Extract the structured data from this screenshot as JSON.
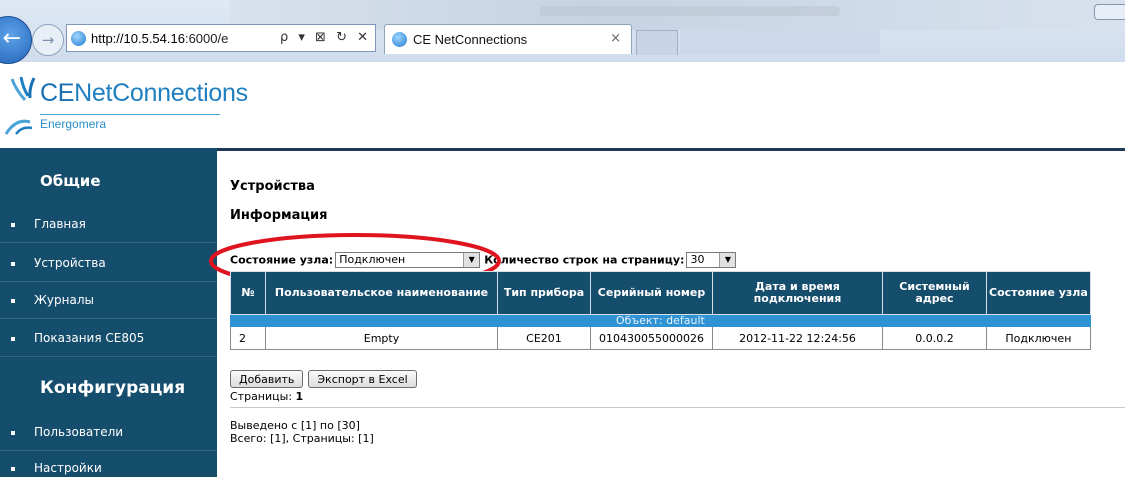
{
  "browser": {
    "url_host": "http://10.5.54.16",
    "url_rest": ":6000/e",
    "tab_title": "CE NetConnections",
    "tab_close": "×",
    "toolbar_glyphs": "ρ ▾ ⊠ ↻ ✕",
    "back_glyph": "←",
    "forward_glyph": "→"
  },
  "logo": {
    "brand_prefix": "CE",
    "brand_rest": "NetConnections",
    "subtitle": "Energomera",
    "colors": {
      "brand": "#1f7fc0",
      "swoosh": "#4aa4d8"
    }
  },
  "sidebar": {
    "section1": "Общие",
    "items1": [
      {
        "label": "Главная"
      },
      {
        "label": "Устройства"
      },
      {
        "label": "Журналы"
      },
      {
        "label": "Показания CE805"
      }
    ],
    "section2": "Конфигурация",
    "items2": [
      {
        "label": "Пользователи"
      },
      {
        "label": "Настройки"
      }
    ],
    "colors": {
      "background": "#154d6c"
    }
  },
  "main": {
    "title": "Устройства",
    "subtitle": "Информация",
    "filters": {
      "state_label": "Состояние узла:",
      "state_value": "Подключен",
      "rows_label": "Количество строк на страницу:",
      "rows_value": "30"
    },
    "table": {
      "headers": [
        "№",
        "Пользовательское наименование",
        "Тип прибора",
        "Серийный номер",
        "Дата и время подключения",
        "Системный адрес",
        "Состояние узла"
      ],
      "group_label": "Объект: default",
      "rows": [
        [
          "2",
          "Empty",
          "CE201",
          "010430055000026",
          "2012-11-22 12:24:56",
          "0.0.0.2",
          "Подключен"
        ]
      ]
    },
    "buttons": {
      "add": "Добавить",
      "export": "Экспорт в Excel"
    },
    "pages_label": "Страницы:",
    "pages_value": "1",
    "summary_line1": "Выведено с [1] по [30]",
    "summary_line2": "Всего: [1], Страницы: [1]",
    "colors": {
      "header_bg": "#154d6c",
      "group_bg": "#2f92d2",
      "annotation": "#e0141e"
    }
  }
}
